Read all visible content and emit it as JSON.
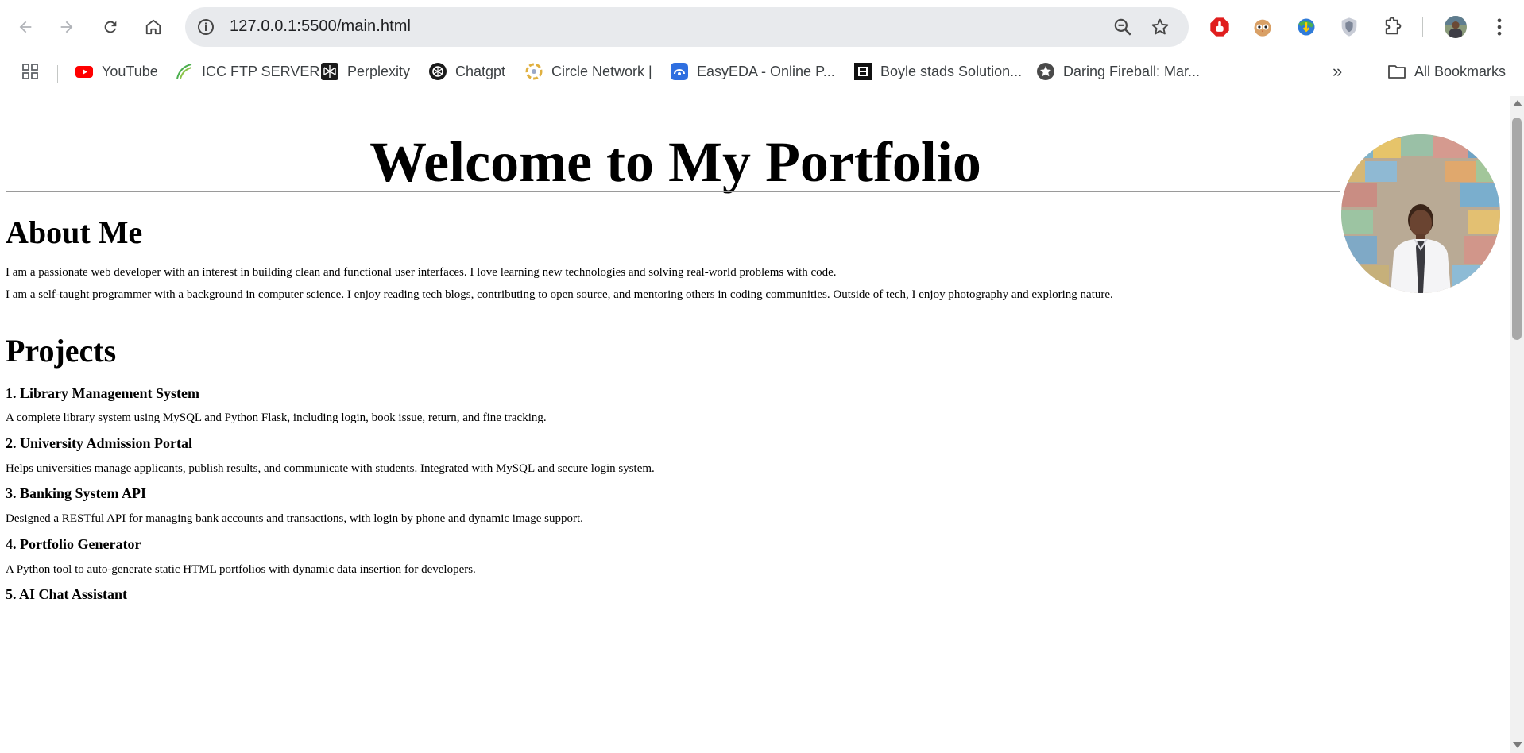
{
  "browser": {
    "url": "127.0.0.1:5500/main.html",
    "back_icon": "back-arrow-icon",
    "forward_icon": "forward-arrow-icon",
    "reload_icon": "reload-icon",
    "home_icon": "home-icon",
    "zoom_icon": "zoom-out-icon",
    "star_icon": "bookmark-star-icon",
    "bookmarks": [
      {
        "label": "YouTube",
        "icon": "youtube-icon"
      },
      {
        "label": "ICC FTP SERVER",
        "icon": "icc-ftp-icon"
      },
      {
        "label": "Perplexity",
        "icon": "perplexity-icon"
      },
      {
        "label": "Chatgpt",
        "icon": "chatgpt-icon"
      },
      {
        "label": "Circle Network |",
        "icon": "circle-network-icon"
      },
      {
        "label": "EasyEDA - Online P...",
        "icon": "easyeda-icon"
      },
      {
        "label": "Boyle stads Solution...",
        "icon": "boyle-icon"
      },
      {
        "label": "Daring Fireball: Mar...",
        "icon": "daring-fireball-icon"
      }
    ],
    "more_bookmarks": "»",
    "all_bookmarks": "All Bookmarks"
  },
  "page": {
    "title": "Welcome to My Portfolio",
    "about": {
      "heading": "About Me",
      "paragraphs": [
        "I am a passionate web developer with an interest in building clean and functional user interfaces. I love learning new technologies and solving real-world problems with code.",
        "I am a self-taught programmer with a background in computer science. I enjoy reading tech blogs, contributing to open source, and mentoring others in coding communities. Outside of tech, I enjoy photography and exploring nature."
      ]
    },
    "projects": {
      "heading": "Projects",
      "items": [
        {
          "title": "1. Library Management System",
          "desc": "A complete library system using MySQL and Python Flask, including login, book issue, return, and fine tracking."
        },
        {
          "title": "2. University Admission Portal",
          "desc": "Helps universities manage applicants, publish results, and communicate with students. Integrated with MySQL and secure login system."
        },
        {
          "title": "3. Banking System API",
          "desc": "Designed a RESTful API for managing bank accounts and transactions, with login by phone and dynamic image support."
        },
        {
          "title": "4. Portfolio Generator",
          "desc": "A Python tool to auto-generate static HTML portfolios with dynamic data insertion for developers."
        },
        {
          "title": "5. AI Chat Assistant",
          "desc": ""
        }
      ]
    }
  },
  "colors": {
    "omnibox_bg": "#e8eaed",
    "youtube_red": "#ff0000",
    "hr": "#9a9a9a"
  }
}
